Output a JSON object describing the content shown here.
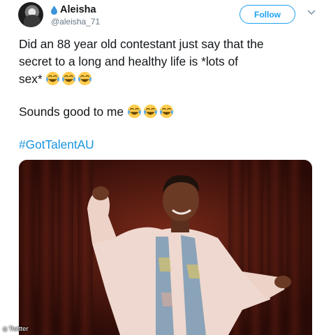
{
  "tweet": {
    "author": {
      "display_name": "Aleisha",
      "handle": "@aleisha_71",
      "badge_icon": "water-drop-icon"
    },
    "follow_label": "Follow",
    "text_lines": [
      "Did an 88 year old contestant just say that the",
      "secret to a long and healthy life is *lots of",
      "sex* "
    ],
    "second_paragraph": "Sounds good to me ",
    "hashtag": "#GotTalentAU",
    "emoji": "face-with-tears-of-joy",
    "media_credit": "Twitter"
  },
  "colors": {
    "accent": "#1da1f2",
    "hashtag": "#1b95e0",
    "text": "#14171a",
    "muted": "#657786"
  }
}
